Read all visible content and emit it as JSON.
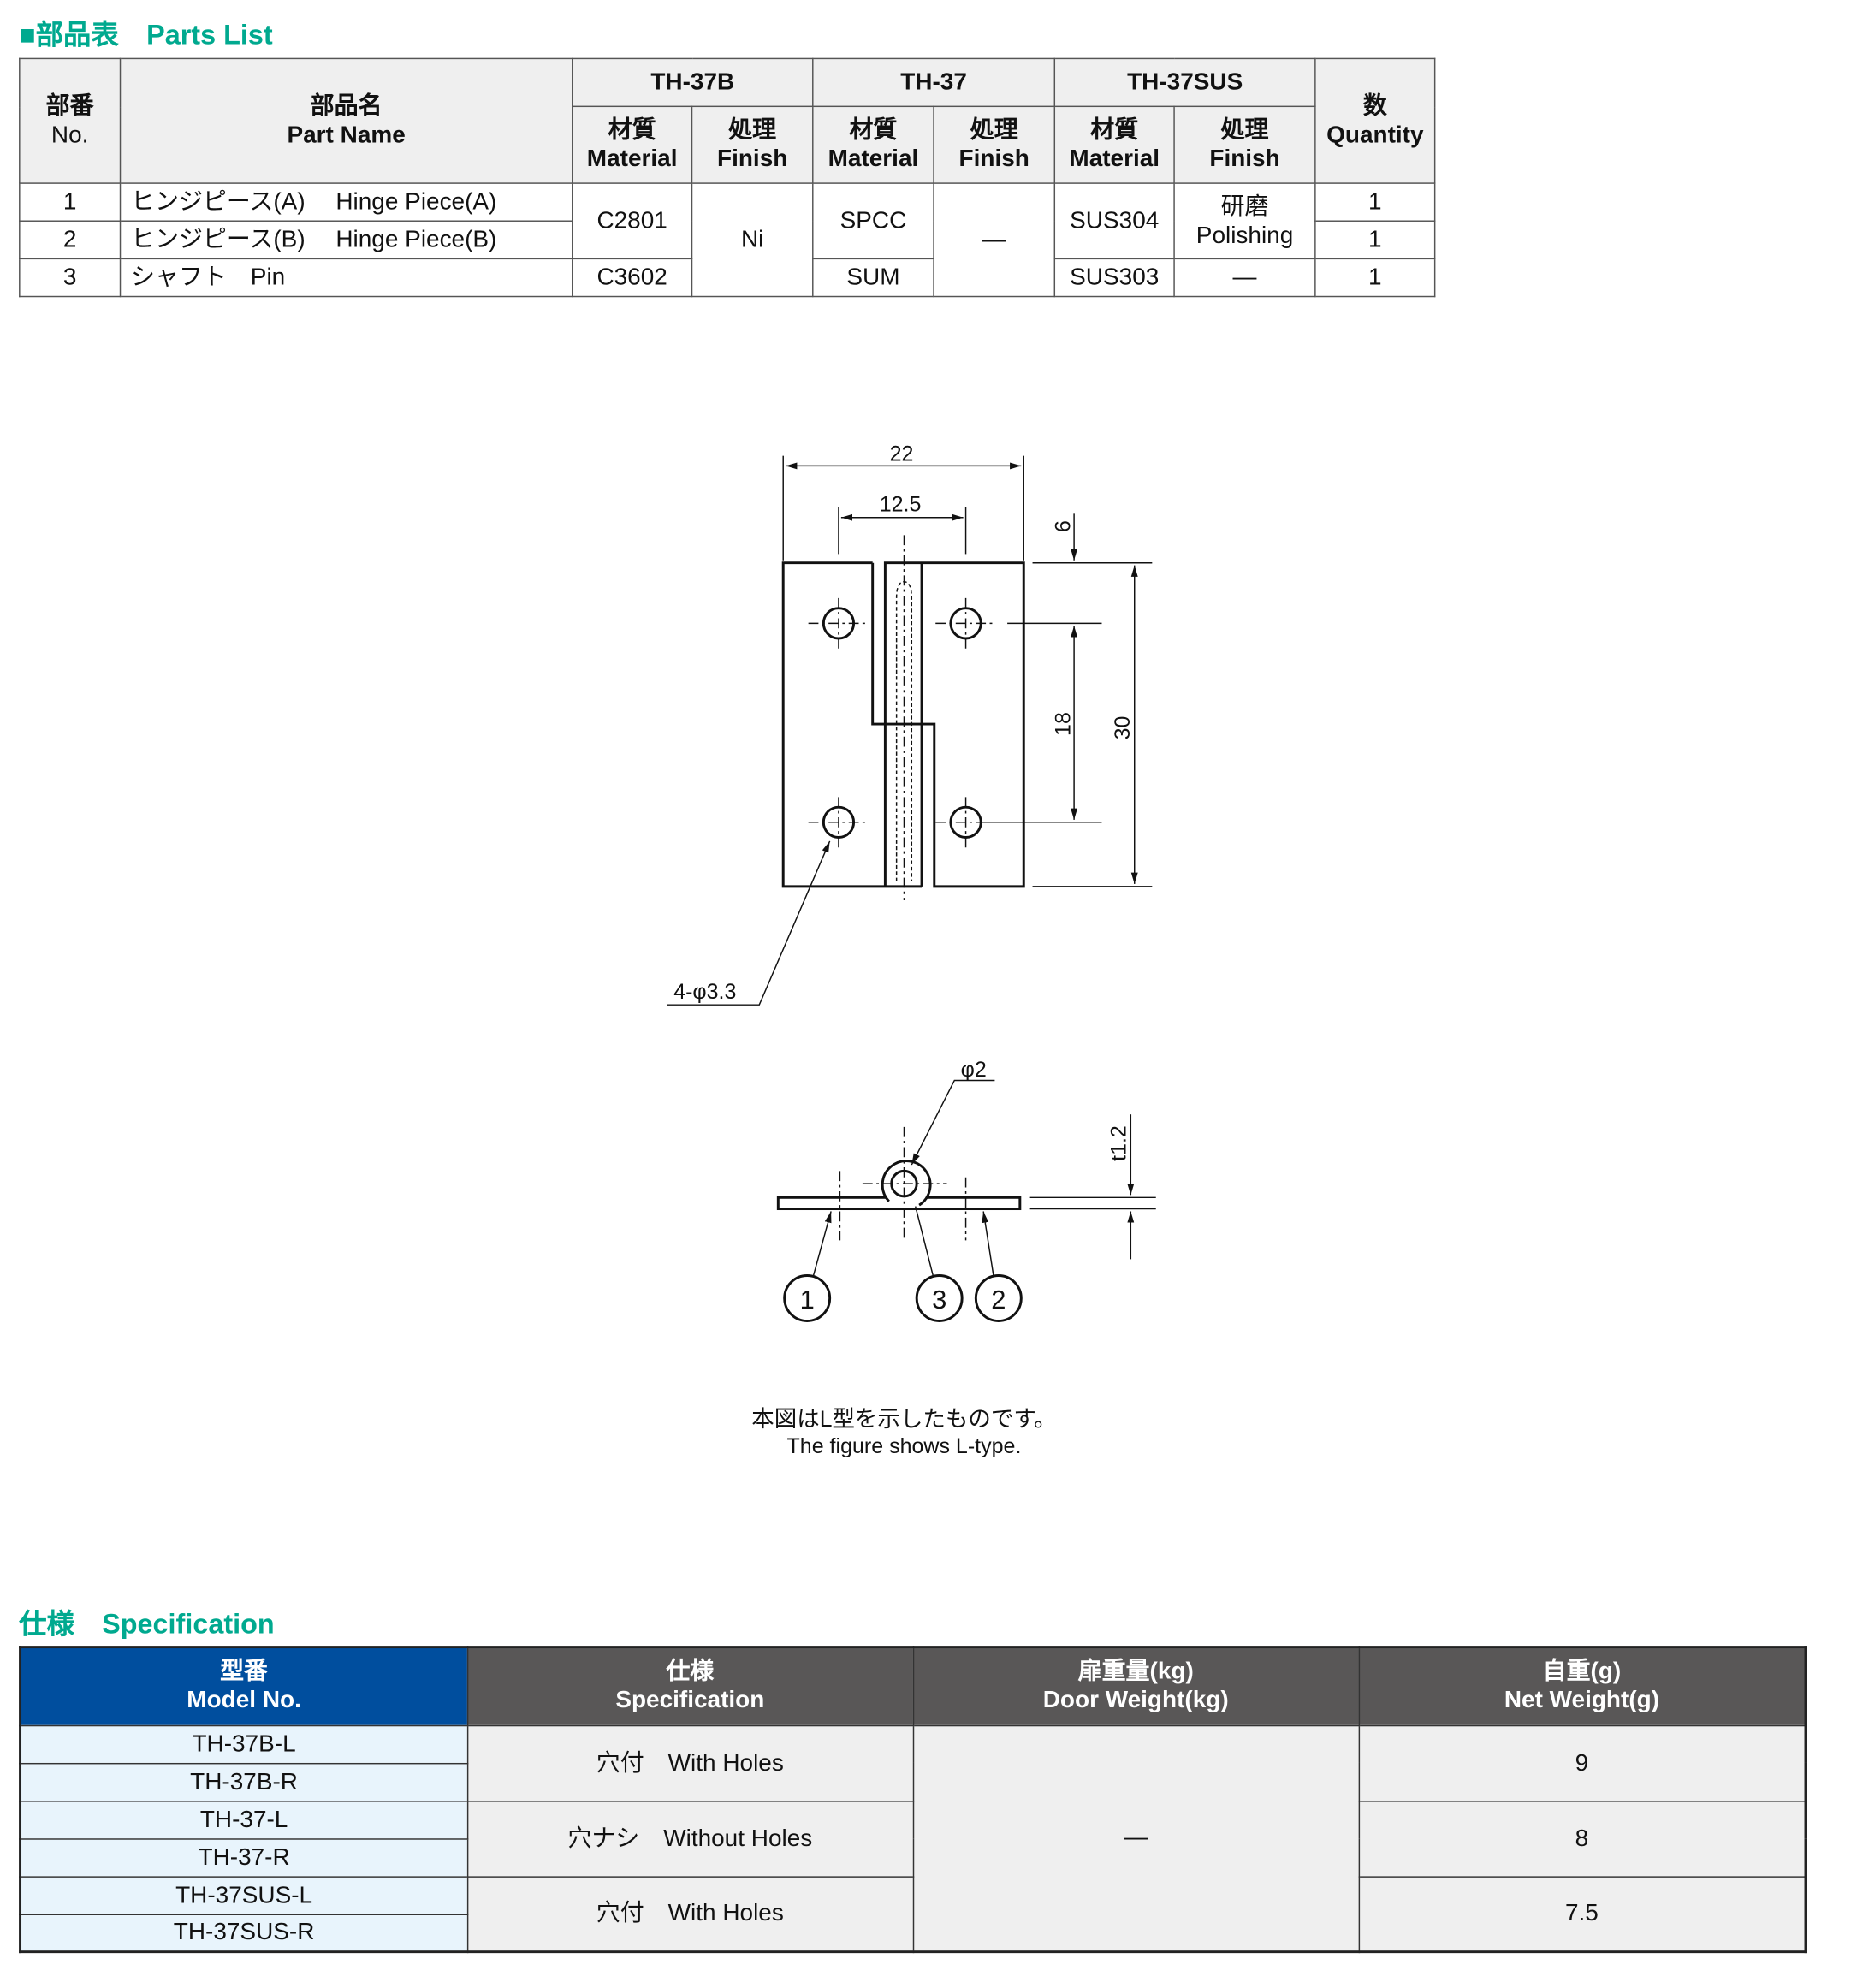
{
  "parts_title": "■部品表　Parts List",
  "parts": {
    "headers": {
      "no_jp": "部番",
      "no_en": "No.",
      "name_jp": "部品名",
      "name_en": "Part Name",
      "models": [
        "TH-37B",
        "TH-37",
        "TH-37SUS"
      ],
      "material_jp": "材質",
      "material_en": "Material",
      "finish_jp": "処理",
      "finish_en": "Finish",
      "qty_jp": "数",
      "qty_en": "Quantity"
    },
    "rows": [
      {
        "no": "1",
        "name": "ヒンジピース(A)　 Hinge Piece(A)",
        "qty": "1"
      },
      {
        "no": "2",
        "name": "ヒンジピース(B)　 Hinge Piece(B)",
        "qty": "1"
      },
      {
        "no": "3",
        "name": "シャフト　Pin",
        "qty": "1"
      }
    ],
    "th37b": {
      "mat_12": "C2801",
      "mat_3": "C3602",
      "finish": "Ni"
    },
    "th37": {
      "mat_12": "SPCC",
      "mat_3": "SUM",
      "finish": "—"
    },
    "th37sus": {
      "mat_12": "SUS304",
      "mat_3": "SUS303",
      "finish_12_jp": "研磨",
      "finish_12_en": "Polishing",
      "finish_3": "—"
    }
  },
  "drawing": {
    "dim_22": "22",
    "dim_12_5": "12.5",
    "dim_6": "6",
    "dim_18": "18",
    "dim_30": "30",
    "holes": "4-φ3.3",
    "pin": "φ2",
    "thickness": "t1.2",
    "balloons": [
      "1",
      "3",
      "2"
    ]
  },
  "caption_jp": "本図はL型を示したものです。",
  "caption_en": "The figure shows L-type.",
  "spec_title": "仕様　Specification",
  "spec": {
    "headers": {
      "model_jp": "型番",
      "model_en": "Model No.",
      "spec_jp": "仕様",
      "spec_en": "Specification",
      "door_jp": "扉重量(kg)",
      "door_en": "Door Weight(kg)",
      "net_jp": "自重(g)",
      "net_en": "Net Weight(g)"
    },
    "models": [
      "TH-37B-L",
      "TH-37B-R",
      "TH-37-L",
      "TH-37-R",
      "TH-37SUS-L",
      "TH-37SUS-R"
    ],
    "specs": [
      "穴付　With Holes",
      "穴ナシ　Without Holes",
      "穴付　With Holes"
    ],
    "door_weight": "—",
    "net_weights": [
      "9",
      "8",
      "7.5"
    ]
  }
}
